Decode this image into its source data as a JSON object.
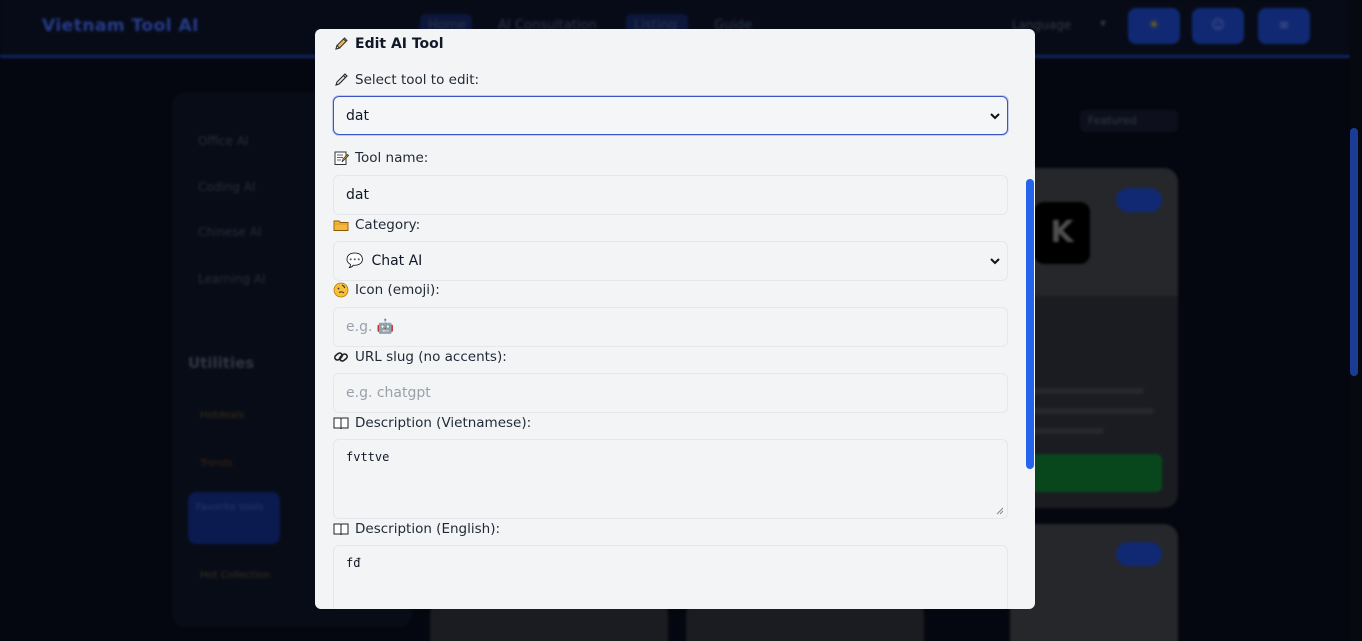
{
  "background": {
    "brand": "Vietnam Tool AI",
    "nav": [
      "Home",
      "AI Consultation",
      "Listing",
      "Guide"
    ],
    "language": "Language",
    "sidebar_items": [
      "Office AI",
      "Coding AI",
      "Chinese AI",
      "Learning AI"
    ],
    "sidebar_heading": "Utilities",
    "chips": [
      "Hotdeals",
      "Trends",
      "Favorite tools",
      "Hot Collection"
    ],
    "filter_label": "Featured",
    "card_logo": "K"
  },
  "modal": {
    "title": "Edit AI Tool",
    "select_tool": {
      "label": "Select tool to edit:",
      "value": "dat"
    },
    "tool_name": {
      "label": "Tool name:",
      "value": "dat"
    },
    "category": {
      "label": "Category:",
      "value_icon": "💬",
      "value": "Chat AI"
    },
    "icon_emoji": {
      "label": "Icon (emoji):",
      "placeholder": "e.g. 🤖"
    },
    "url_slug": {
      "label": "URL slug (no accents):",
      "placeholder": "e.g. chatgpt"
    },
    "description_vi": {
      "label": "Description (Vietnamese):",
      "value": "fvttve"
    },
    "description_en": {
      "label": "Description (English):",
      "value": "fđ"
    }
  },
  "icons": {
    "title": "pencil-icon",
    "select_tool": "pen-icon",
    "tool_name": "memo-icon",
    "category": "folder-icon",
    "icon_emoji": "face-icon",
    "url_slug": "link-icon",
    "description": "book-icon"
  },
  "colors": {
    "accent": "#2563eb",
    "focus_border": "#3b55c9",
    "folder": "#f5b83d"
  }
}
